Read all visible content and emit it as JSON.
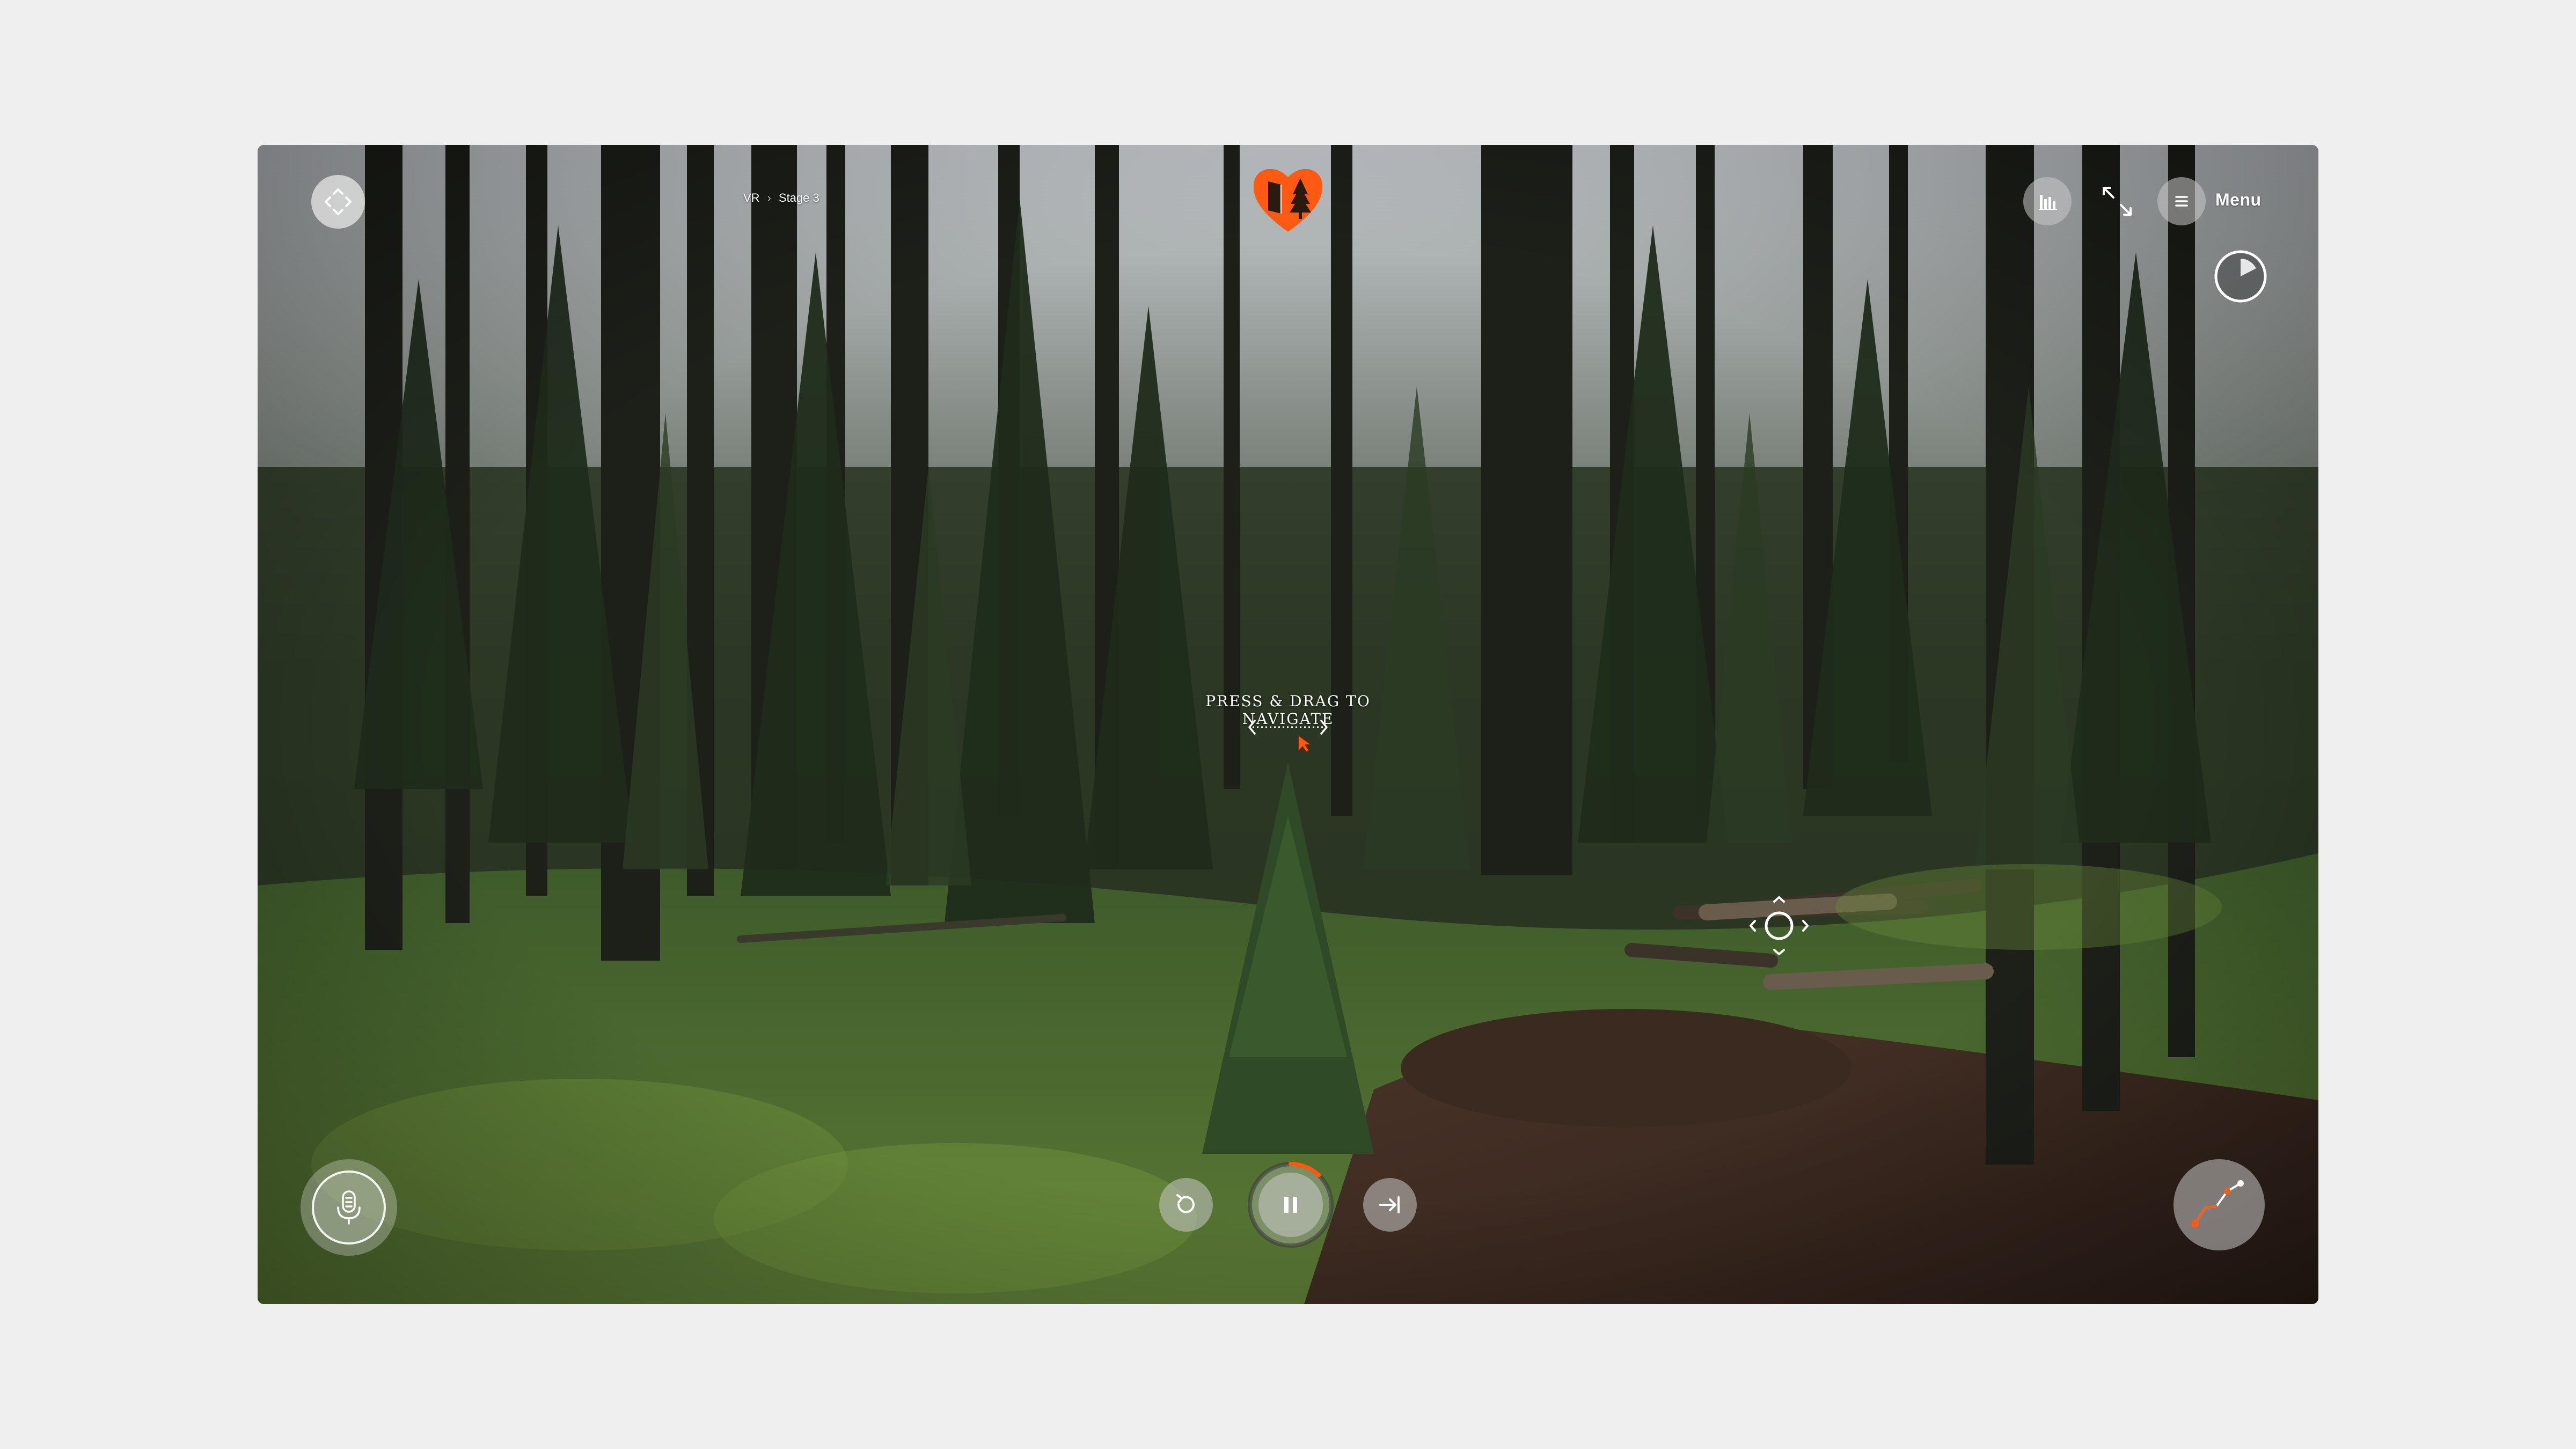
{
  "breadcrumb": {
    "root": "VR",
    "separator": "›",
    "current": "Stage 3"
  },
  "header": {
    "logo_icon": "heart-book-tree-logo",
    "brand_color": "#ff5a14"
  },
  "top_right": {
    "stats_icon": "bar-chart-icon",
    "fullscreen_icon": "expand-arrows-icon",
    "menu_icon": "hamburger-icon",
    "menu_label": "Menu",
    "compass_icon": "compass-dial-icon"
  },
  "hint": {
    "text": "PRESS & DRAG TO NAVIGATE",
    "icon": "drag-arrows-icon"
  },
  "player": {
    "restart_icon": "restart-icon",
    "pause_icon": "pause-icon",
    "skip_icon": "skip-to-end-icon",
    "progress": 0.12
  },
  "bottom_left": {
    "mic_icon": "microphone-icon"
  },
  "bottom_right": {
    "map_icon": "trail-map-icon"
  },
  "scene": {
    "hotspot_icon": "navigation-hotspot-icon"
  }
}
